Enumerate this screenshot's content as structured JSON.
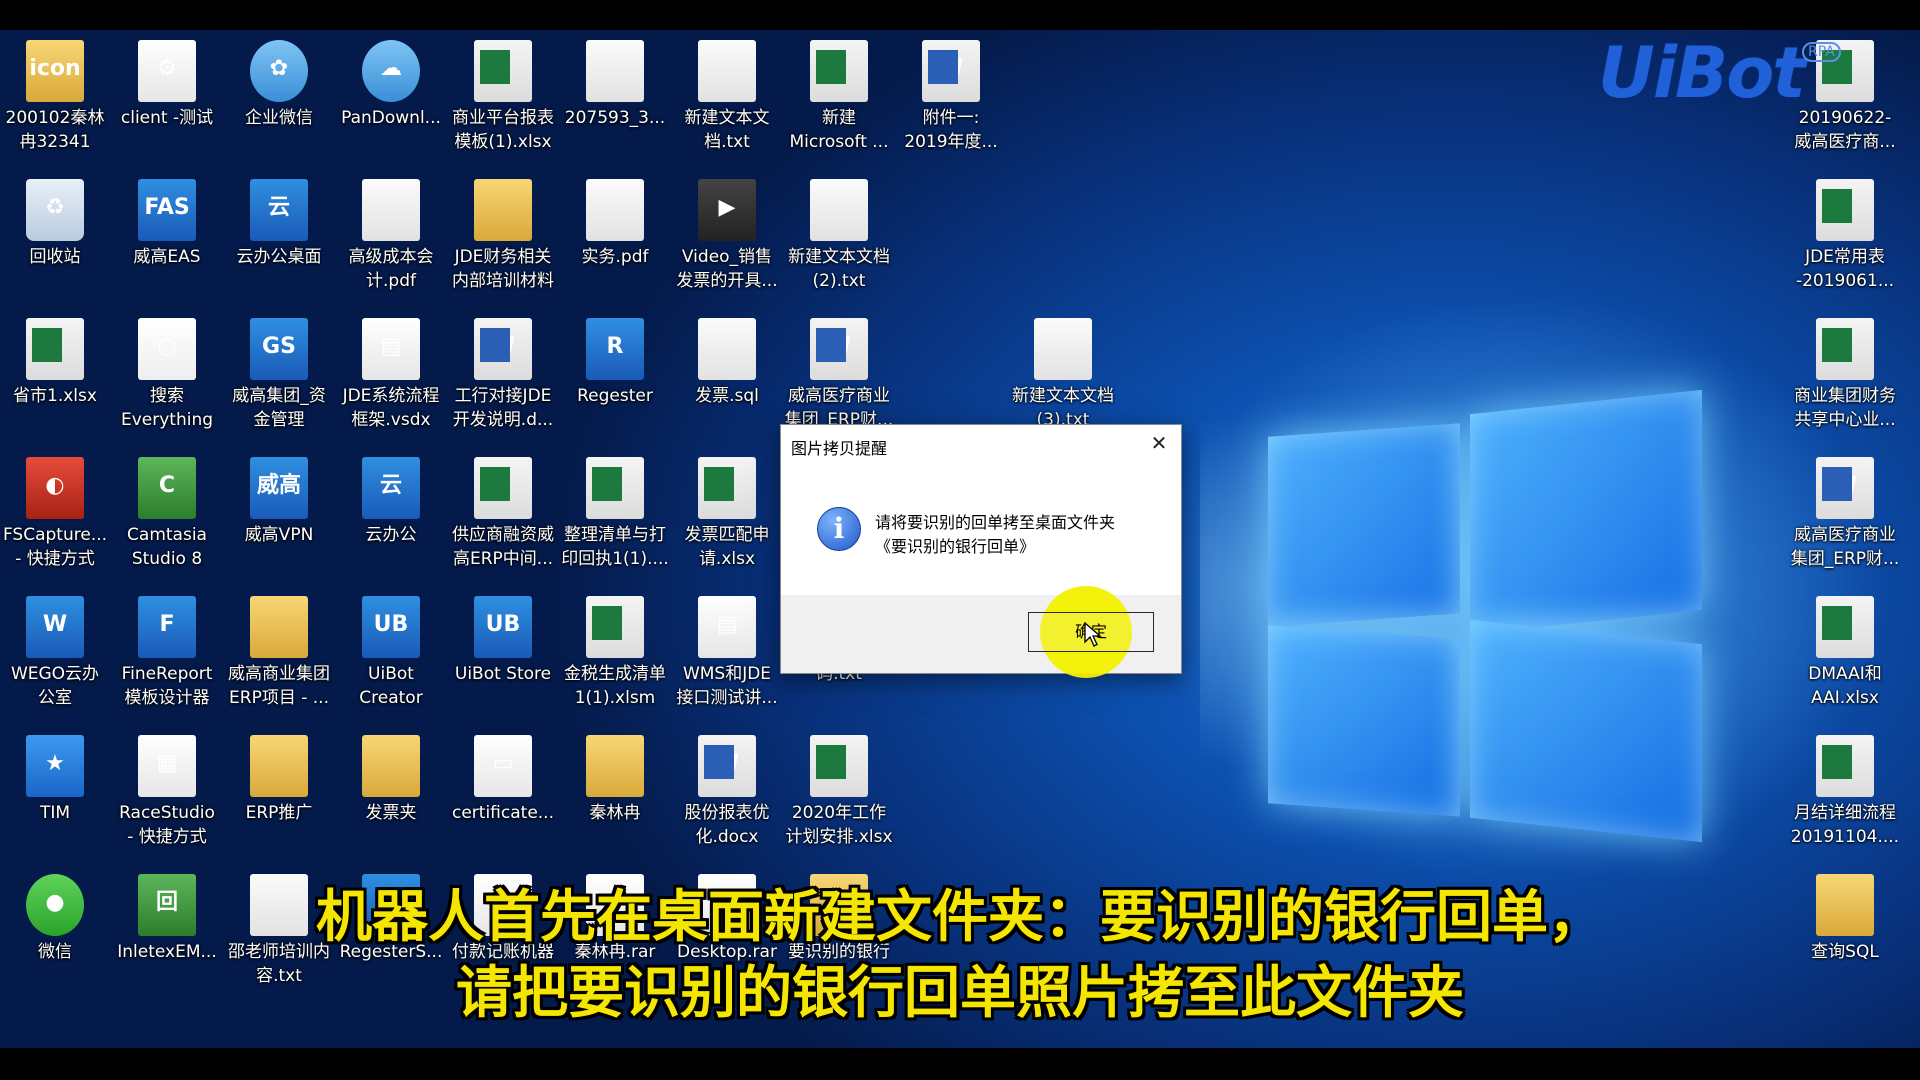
{
  "brand": {
    "name": "UiBot",
    "badge": "RPA"
  },
  "icons": [
    {
      "id": "icon-1",
      "label": "200102秦林\n冉32341",
      "kind": "folder",
      "glyph": "icon"
    },
    {
      "id": "icon-2",
      "label": "client -测试",
      "kind": "white",
      "glyph": "⚙"
    },
    {
      "id": "icon-3",
      "label": "企业微信",
      "kind": "cloud",
      "glyph": "✿"
    },
    {
      "id": "icon-4",
      "label": "PanDownl...",
      "kind": "cloud",
      "glyph": "☁"
    },
    {
      "id": "icon-5",
      "label": "商业平台报表\n模板(1).xlsx",
      "kind": "excel",
      "glyph": "X"
    },
    {
      "id": "icon-6",
      "label": "207593_3...",
      "kind": "doc",
      "glyph": ""
    },
    {
      "id": "icon-7",
      "label": "新建文本文\n档.txt",
      "kind": "doc",
      "glyph": ""
    },
    {
      "id": "icon-8",
      "label": "新建\nMicrosoft ...",
      "kind": "excel",
      "glyph": "X"
    },
    {
      "id": "icon-9",
      "label": "附件一:\n2019年度...",
      "kind": "word",
      "glyph": "W"
    },
    {
      "id": "icon-10",
      "label": "20190622-\n威高医疗商...",
      "kind": "excel",
      "glyph": "X"
    },
    {
      "id": "icon-11",
      "label": "回收站",
      "kind": "bin",
      "glyph": "♻"
    },
    {
      "id": "icon-12",
      "label": "威高EAS",
      "kind": "app",
      "glyph": "FAS"
    },
    {
      "id": "icon-13",
      "label": "云办公桌面",
      "kind": "app",
      "glyph": "云"
    },
    {
      "id": "icon-14",
      "label": "高级成本会\n计.pdf",
      "kind": "doc",
      "glyph": ""
    },
    {
      "id": "icon-15",
      "label": "JDE财务相关\n内部培训材料",
      "kind": "folder",
      "glyph": ""
    },
    {
      "id": "icon-16",
      "label": "实务.pdf",
      "kind": "doc",
      "glyph": ""
    },
    {
      "id": "icon-17",
      "label": "Video_销售\n发票的开具...",
      "kind": "dark",
      "glyph": "▶"
    },
    {
      "id": "icon-18",
      "label": "新建文本文档\n(2).txt",
      "kind": "doc",
      "glyph": ""
    },
    {
      "id": "icon-19",
      "label": "JDE常用表\n-2019061...",
      "kind": "excel",
      "glyph": "X"
    },
    {
      "id": "icon-20",
      "label": "省市1.xlsx",
      "kind": "excel",
      "glyph": "X"
    },
    {
      "id": "icon-21",
      "label": "搜索\nEverything",
      "kind": "orange",
      "glyph": "○"
    },
    {
      "id": "icon-22",
      "label": "威高集团_资\n金管理",
      "kind": "app",
      "glyph": "GS"
    },
    {
      "id": "icon-23",
      "label": "JDE系统流程\n框架.vsdx",
      "kind": "white",
      "glyph": "▤"
    },
    {
      "id": "icon-24",
      "label": "工行对接JDE\n开发说明.d...",
      "kind": "word",
      "glyph": "W"
    },
    {
      "id": "icon-25",
      "label": "Regester",
      "kind": "app",
      "glyph": "R"
    },
    {
      "id": "icon-26",
      "label": "发票.sql",
      "kind": "doc",
      "glyph": ""
    },
    {
      "id": "icon-27",
      "label": "威高医疗商业\n集团_ERP财...",
      "kind": "word",
      "glyph": "W"
    },
    {
      "id": "icon-28",
      "label": "新建文本文档\n(3).txt",
      "kind": "doc",
      "glyph": ""
    },
    {
      "id": "icon-29",
      "label": "商业集团财务\n共享中心业...",
      "kind": "excel",
      "glyph": "X"
    },
    {
      "id": "icon-30",
      "label": "FSCapture...\n- 快捷方式",
      "kind": "red",
      "glyph": "◐"
    },
    {
      "id": "icon-31",
      "label": "Camtasia\nStudio 8",
      "kind": "green",
      "glyph": "C"
    },
    {
      "id": "icon-32",
      "label": "威高VPN",
      "kind": "app",
      "glyph": "威高"
    },
    {
      "id": "icon-33",
      "label": "云办公",
      "kind": "app",
      "glyph": "云"
    },
    {
      "id": "icon-34",
      "label": "供应商融资威\n高ERP中间...",
      "kind": "excel",
      "glyph": "X"
    },
    {
      "id": "icon-35",
      "label": "整理清单与打\n印回执1(1)....",
      "kind": "excel",
      "glyph": "X"
    },
    {
      "id": "icon-36",
      "label": "发票匹配申\n请.xlsx",
      "kind": "excel",
      "glyph": "X"
    },
    {
      "id": "icon-37",
      "label": "威高医疗商业\n集团_ERP财...",
      "kind": "word",
      "glyph": "W"
    },
    {
      "id": "icon-38",
      "label": "WEGO云办\n公室",
      "kind": "app",
      "glyph": "W"
    },
    {
      "id": "icon-39",
      "label": "FineReport\n模板设计器",
      "kind": "app",
      "glyph": "F"
    },
    {
      "id": "icon-40",
      "label": "威高商业集团\nERP项目 - ...",
      "kind": "folder",
      "glyph": ""
    },
    {
      "id": "icon-41",
      "label": "UiBot\nCreator",
      "kind": "app",
      "glyph": "UB"
    },
    {
      "id": "icon-42",
      "label": "UiBot Store",
      "kind": "app",
      "glyph": "UB"
    },
    {
      "id": "icon-43",
      "label": "金税生成清单\n1(1).xlsm",
      "kind": "excel",
      "glyph": "X"
    },
    {
      "id": "icon-44",
      "label": "WMS和JDE\n接口测试讲...",
      "kind": "white",
      "glyph": "▤"
    },
    {
      "id": "icon-45",
      "label": "码.txt",
      "kind": "doc",
      "glyph": ""
    },
    {
      "id": "icon-46",
      "label": "DMAAI和\nAAI.xlsx",
      "kind": "excel",
      "glyph": "X"
    },
    {
      "id": "icon-47",
      "label": "TIM",
      "kind": "star",
      "glyph": "★"
    },
    {
      "id": "icon-48",
      "label": "RaceStudio\n- 快捷方式",
      "kind": "white",
      "glyph": "▦"
    },
    {
      "id": "icon-49",
      "label": "ERP推广",
      "kind": "folder",
      "glyph": ""
    },
    {
      "id": "icon-50",
      "label": "发票夹",
      "kind": "folder",
      "glyph": ""
    },
    {
      "id": "icon-51",
      "label": "certificate...",
      "kind": "white",
      "glyph": "▭"
    },
    {
      "id": "icon-52",
      "label": "秦林冉",
      "kind": "folder",
      "glyph": ""
    },
    {
      "id": "icon-53",
      "label": "股份报表优\n化.docx",
      "kind": "word",
      "glyph": "W"
    },
    {
      "id": "icon-54",
      "label": "2020年工作\n计划安排.xlsx",
      "kind": "excel",
      "glyph": "X"
    },
    {
      "id": "icon-55",
      "label": "月结详细流程\n20191104....",
      "kind": "excel",
      "glyph": "X"
    },
    {
      "id": "icon-56",
      "label": "微信",
      "kind": "chat",
      "glyph": "●"
    },
    {
      "id": "icon-57",
      "label": "InletexEM...",
      "kind": "green",
      "glyph": "回"
    },
    {
      "id": "icon-58",
      "label": "邵老师培训内\n容.txt",
      "kind": "doc",
      "glyph": ""
    },
    {
      "id": "icon-59",
      "label": "RegesterS...",
      "kind": "app",
      "glyph": ""
    },
    {
      "id": "icon-60",
      "label": "付款记账机器\n人",
      "kind": "white",
      "glyph": ""
    },
    {
      "id": "icon-61",
      "label": "秦林冉.rar",
      "kind": "white",
      "glyph": ""
    },
    {
      "id": "icon-62",
      "label": "Desktop.rar",
      "kind": "white",
      "glyph": ""
    },
    {
      "id": "icon-63",
      "label": "要识别的银行",
      "kind": "folder",
      "glyph": ""
    },
    {
      "id": "icon-64",
      "label": "查询SQL",
      "kind": "folder",
      "glyph": ""
    }
  ],
  "dialog": {
    "title": "图片拷贝提醒",
    "close": "✕",
    "info_glyph": "i",
    "message_line1": "请将要识别的回单拷至桌面文件夹",
    "message_line2": "《要识别的银行回单》",
    "ok_label": "确定"
  },
  "subtitles": {
    "line1": "机器人首先在桌面新建文件夹：要识别的银行回单，",
    "line2": "请把要识别的银行回单照片拷至此文件夹"
  },
  "colors": {
    "subtitle": "#f4e600",
    "highlight": "#f3f000",
    "desktop_blue": "#0c4fae"
  }
}
